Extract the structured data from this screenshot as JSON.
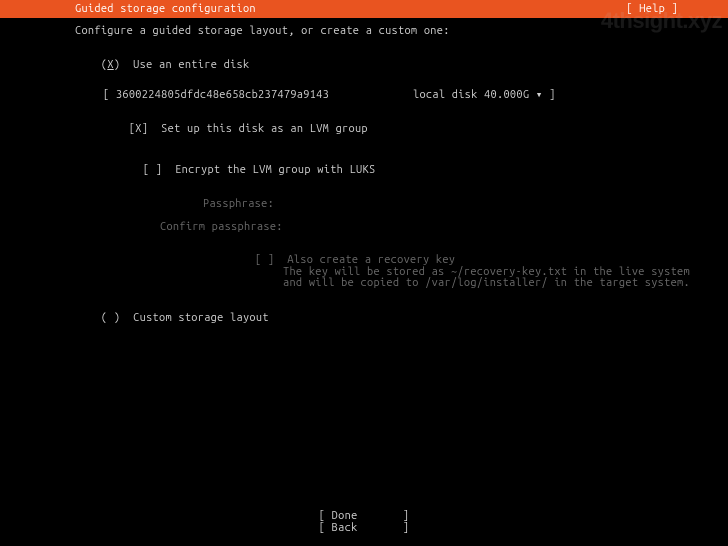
{
  "watermark": "4thsight.xyz",
  "header": {
    "title": "Guided storage configuration",
    "help": "[ Help ]"
  },
  "intro": "Configure a guided storage layout, or create a custom one:",
  "entire_disk": {
    "radio": "(X)",
    "label": "Use an entire disk",
    "disk_bracket_open": "[ ",
    "disk_id": "3600224805dfdc48e658cb237479a9143",
    "disk_desc": "local disk 40.000G ▾ ]"
  },
  "lvm": {
    "check": "[X]",
    "label": "Set up this disk as an LVM group"
  },
  "encrypt": {
    "check": "[ ]",
    "label": "Encrypt the LVM group with LUKS"
  },
  "passphrase_label": "Passphrase:",
  "confirm_label": "Confirm passphrase:",
  "recovery": {
    "check": "[ ]",
    "line1": "Also create a recovery key",
    "line2": "The key will be stored as ~/recovery-key.txt in the live system",
    "line3": "and will be copied to /var/log/installer/ in the target system."
  },
  "custom": {
    "radio": "( )",
    "label": "Custom storage layout"
  },
  "footer": {
    "done": "[ Done       ]",
    "back": "[ Back       ]"
  }
}
